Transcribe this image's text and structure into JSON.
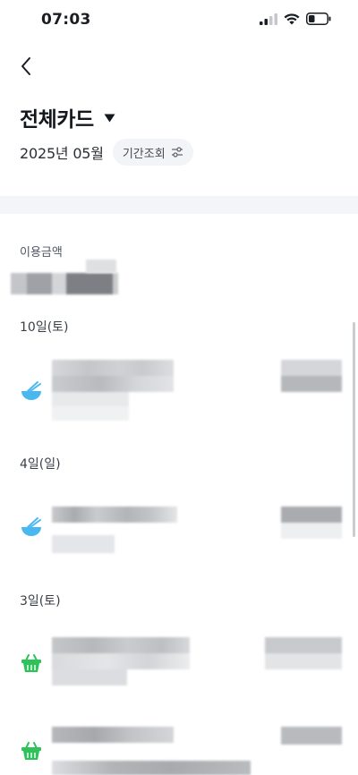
{
  "status_bar": {
    "time": "07:03",
    "icons": [
      "cellular-signal-icon",
      "wifi-icon",
      "battery-icon"
    ]
  },
  "header": {
    "back_icon": "chevron-left-icon",
    "title": "전체카드",
    "title_caret_icon": "caret-down-icon"
  },
  "period": {
    "label": "2025년 05월",
    "button_label": "기간조회",
    "button_icon": "filter-sliders-icon"
  },
  "summary": {
    "amount_label": "이용금액"
  },
  "transaction_groups": [
    {
      "date": "10일(토)",
      "items": [
        {
          "category_icon": "bowl-chopsticks-icon",
          "category_color": "#4AB8F0"
        }
      ]
    },
    {
      "date": "4일(일)",
      "items": [
        {
          "category_icon": "bowl-chopsticks-icon",
          "category_color": "#4AB8F0"
        }
      ]
    },
    {
      "date": "3일(토)",
      "items": [
        {
          "category_icon": "shopping-basket-icon",
          "category_color": "#2FC25A"
        },
        {
          "category_icon": "shopping-basket-icon",
          "category_color": "#2FC25A"
        }
      ]
    }
  ],
  "colors": {
    "background": "#FFFFFF",
    "divider_band": "#F4F5F8",
    "period_button_bg": "#F3F4F7",
    "food_icon": "#4AB8F0",
    "shopping_icon": "#2FC25A"
  }
}
